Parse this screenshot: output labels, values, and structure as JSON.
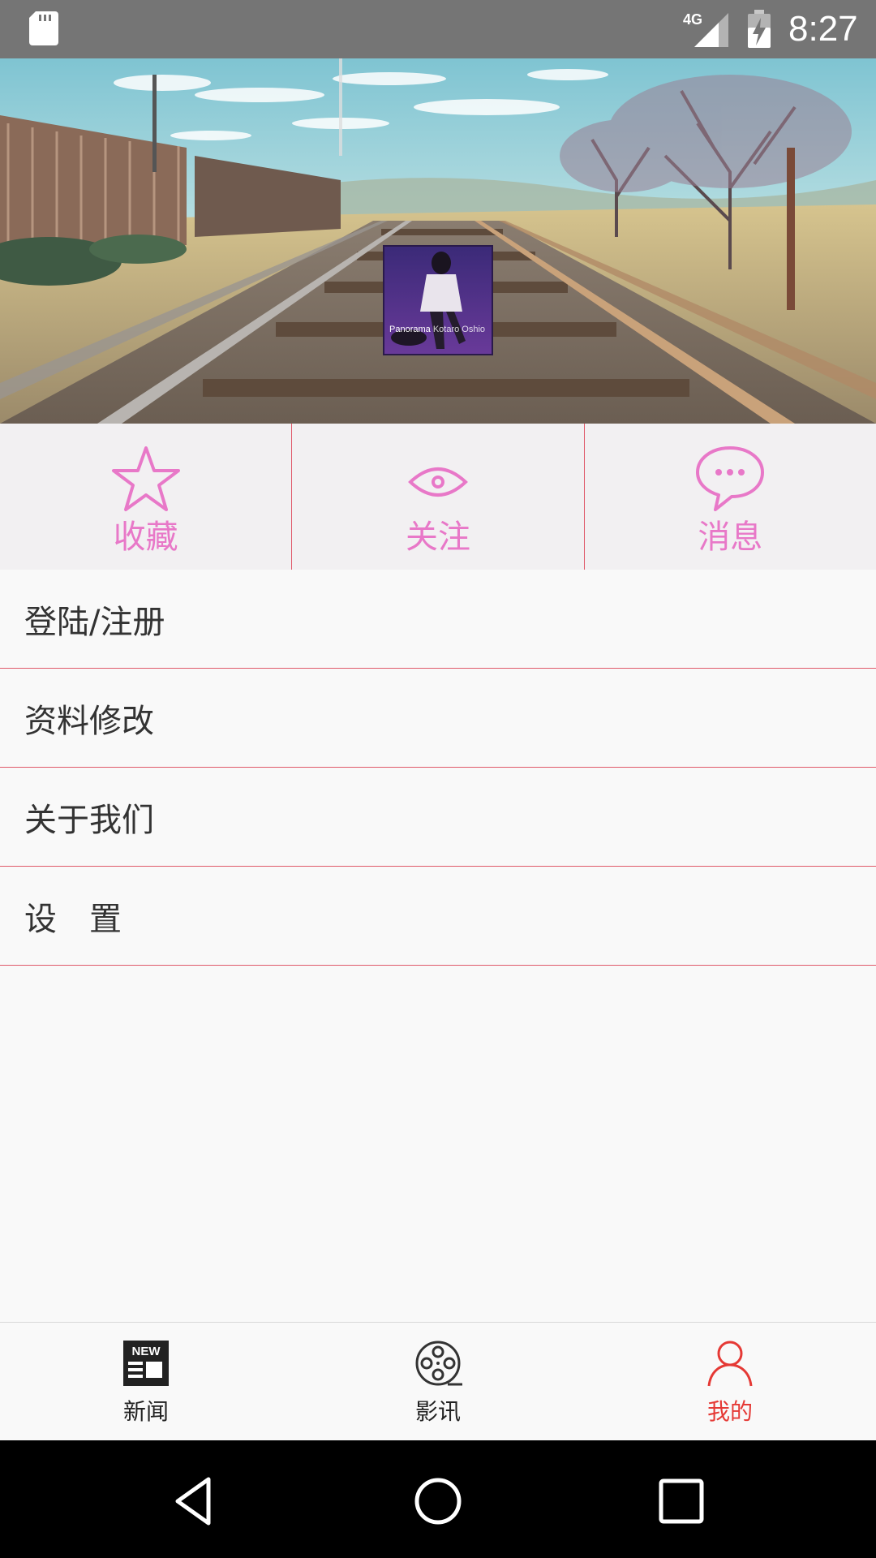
{
  "status_bar": {
    "time": "8:27",
    "network": "4G",
    "icons": [
      "sd-card-icon",
      "cell-signal-icon",
      "battery-charging-icon"
    ]
  },
  "header": {
    "avatar": {
      "caption_left": "Panorama",
      "caption_right": "Kotaro Oshio"
    }
  },
  "quick_actions": [
    {
      "label": "收藏",
      "icon": "star-icon"
    },
    {
      "label": "关注",
      "icon": "eye-icon"
    },
    {
      "label": "消息",
      "icon": "chat-bubble-icon"
    }
  ],
  "menu": [
    {
      "label": "登陆/注册"
    },
    {
      "label": "资料修改"
    },
    {
      "label": "关于我们"
    },
    {
      "label": "设　置"
    }
  ],
  "tabbar": {
    "active": "我的",
    "tabs": [
      {
        "label": "新闻",
        "icon": "news-icon",
        "icon_text": "NEW"
      },
      {
        "label": "影讯",
        "icon": "film-reel-icon"
      },
      {
        "label": "我的",
        "icon": "person-icon"
      }
    ]
  },
  "colors": {
    "accent_pink": "#e878c8",
    "divider_red": "#e05a6a",
    "active_tab": "#e53935",
    "status_bar": "#757575"
  }
}
